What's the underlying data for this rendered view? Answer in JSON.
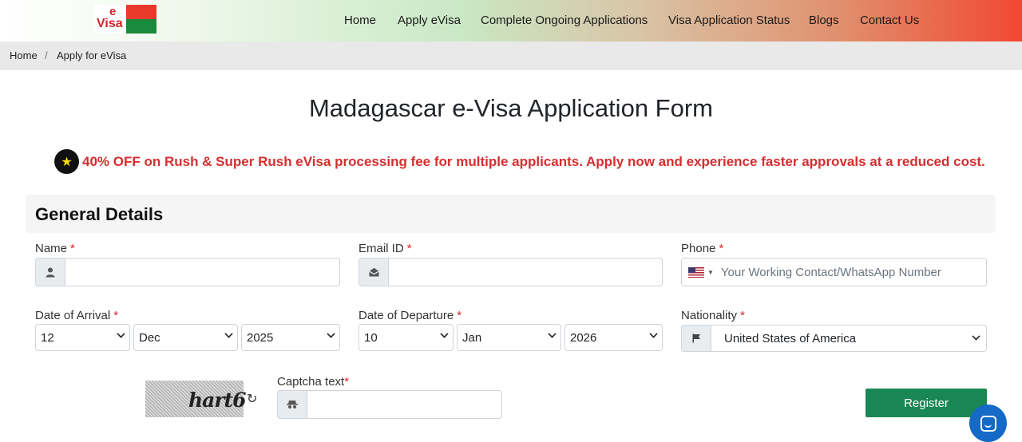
{
  "logo": {
    "letter": "e",
    "word": "Visa"
  },
  "nav": [
    "Home",
    "Apply eVisa",
    "Complete Ongoing Applications",
    "Visa Application Status",
    "Blogs",
    "Contact Us"
  ],
  "breadcrumb": {
    "home": "Home",
    "separator": "/",
    "current": "Apply for eVisa"
  },
  "page_title": "Madagascar e-Visa Application Form",
  "promo": {
    "badge_icon": "star-icon",
    "text": "40% OFF on Rush & Super Rush eVisa processing fee for multiple applicants. Apply now and experience faster approvals at a reduced cost."
  },
  "section": {
    "title": "General Details"
  },
  "form": {
    "required_mark": "*",
    "name": {
      "label": "Name",
      "value": ""
    },
    "email": {
      "label": "Email ID",
      "value": ""
    },
    "phone": {
      "label": "Phone",
      "placeholder": "Your Working Contact/WhatsApp Number"
    },
    "arrival": {
      "label": "Date of Arrival",
      "day": "12",
      "month": "Dec",
      "year": "2025"
    },
    "departure": {
      "label": "Date of Departure",
      "day": "10",
      "month": "Jan",
      "year": "2026"
    },
    "nationality": {
      "label": "Nationality",
      "value": "United States of America"
    },
    "captcha": {
      "image_text": "hart6",
      "label": "Captcha text",
      "value": ""
    },
    "register_label": "Register"
  },
  "colors": {
    "primary_green": "#198754",
    "promo_red": "#d62e2e",
    "chat_blue": "#1569c7"
  }
}
